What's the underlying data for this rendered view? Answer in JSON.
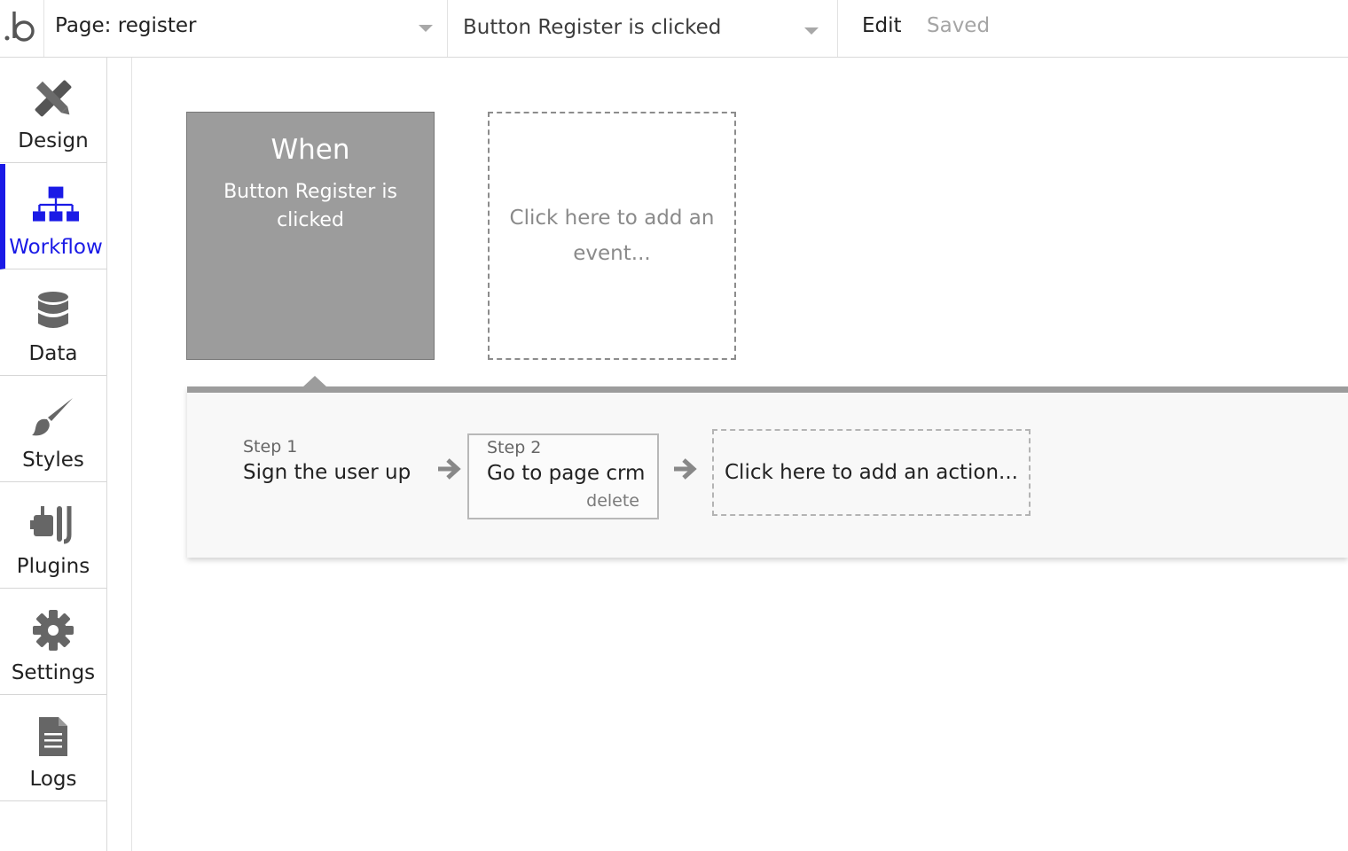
{
  "header": {
    "logo_icon": "bubble-logo-icon",
    "page_selector": {
      "label": "Page: register"
    },
    "event_selector": {
      "label": "Button Register is clicked"
    },
    "edit_label": "Edit",
    "save_status": "Saved"
  },
  "sidebar": {
    "active": "Workflow",
    "accent_color": "#1a1ae6",
    "items": [
      {
        "label": "Design",
        "icon": "design-tools-icon"
      },
      {
        "label": "Workflow",
        "icon": "workflow-tree-icon"
      },
      {
        "label": "Data",
        "icon": "database-icon"
      },
      {
        "label": "Styles",
        "icon": "paintbrush-icon"
      },
      {
        "label": "Plugins",
        "icon": "plugin-icon"
      },
      {
        "label": "Settings",
        "icon": "gear-icon"
      },
      {
        "label": "Logs",
        "icon": "document-icon"
      }
    ]
  },
  "canvas": {
    "event_card": {
      "heading": "When",
      "description": "Button Register is clicked"
    },
    "add_event": "Click here to add an event...",
    "actions": {
      "steps": [
        {
          "number": "Step 1",
          "title": "Sign the user up"
        },
        {
          "number": "Step 2",
          "title": "Go to page crm",
          "delete_label": "delete"
        }
      ],
      "add_action": "Click here to add an action..."
    }
  }
}
